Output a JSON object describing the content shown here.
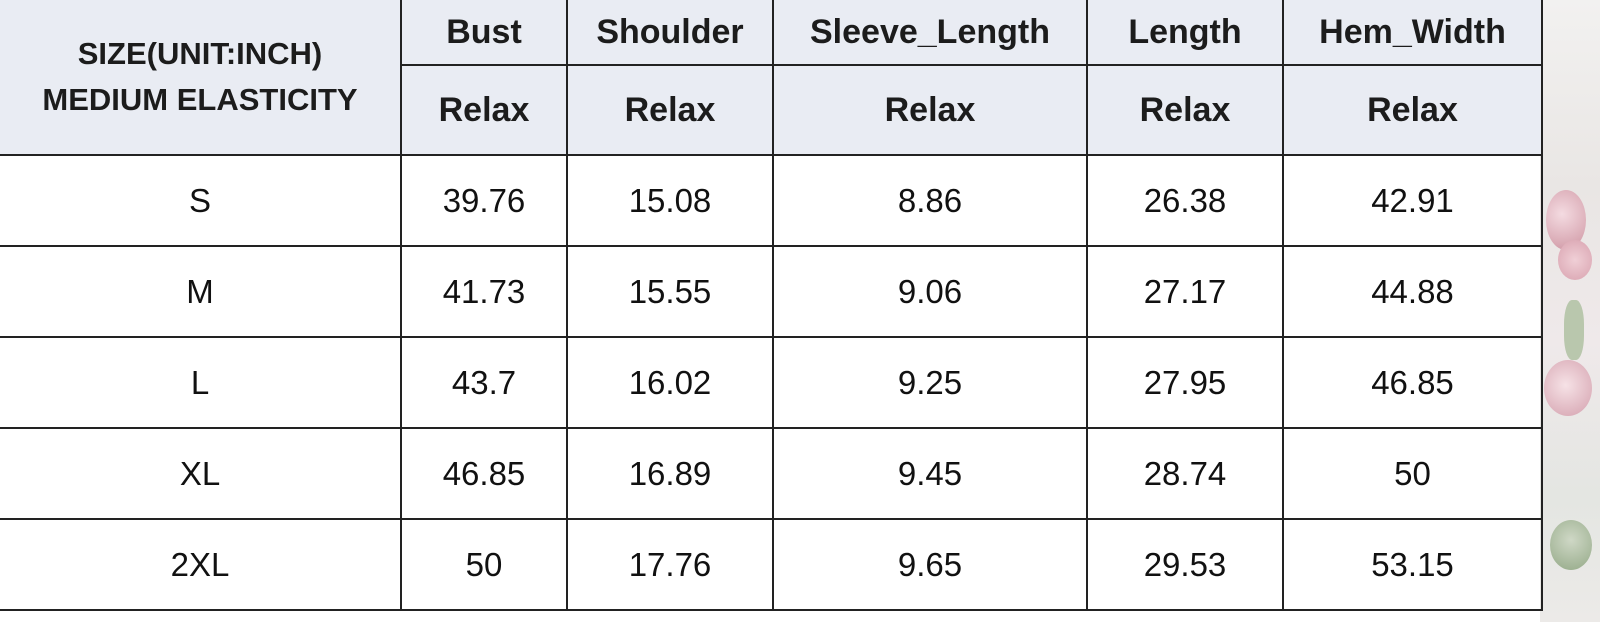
{
  "table": {
    "title_lines": [
      "SIZE(UNIT:INCH)",
      "MEDIUM ELASTICITY"
    ],
    "columns": [
      "Bust",
      "Shoulder",
      "Sleeve_Length",
      "Length",
      "Hem_Width"
    ],
    "sub_headers": [
      "Relax",
      "Relax",
      "Relax",
      "Relax",
      "Relax"
    ],
    "rows": [
      {
        "size": "S",
        "values": [
          "39.76",
          "15.08",
          "8.86",
          "26.38",
          "42.91"
        ]
      },
      {
        "size": "M",
        "values": [
          "41.73",
          "15.55",
          "9.06",
          "27.17",
          "44.88"
        ]
      },
      {
        "size": "L",
        "values": [
          "43.7",
          "16.02",
          "9.25",
          "27.95",
          "46.85"
        ]
      },
      {
        "size": "XL",
        "values": [
          "46.85",
          "16.89",
          "9.45",
          "28.74",
          "50"
        ]
      },
      {
        "size": "2XL",
        "values": [
          "50",
          "17.76",
          "9.65",
          "29.53",
          "53.15"
        ]
      }
    ]
  },
  "colors": {
    "header_background": "#e9ecf3",
    "grid_line": "#222222",
    "text": "#111111"
  }
}
